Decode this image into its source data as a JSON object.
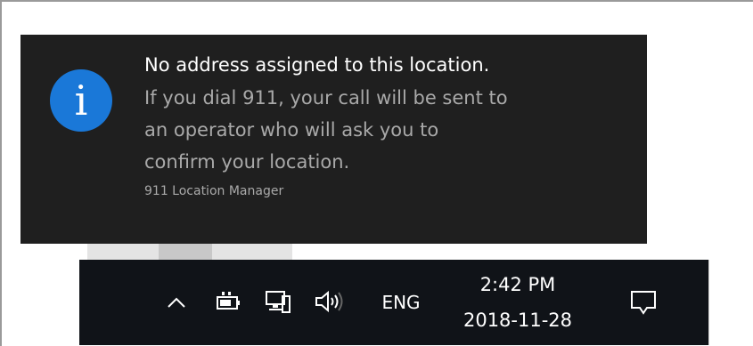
{
  "toast": {
    "icon": "info-icon",
    "icon_glyph": "i",
    "title": "No address assigned to this location.",
    "body_lines": [
      "If you dial 911, your call will be sent to",
      "an operator who will ask you to",
      "confirm your location."
    ],
    "source": "911 Location Manager",
    "icon_color": "#1a78d8",
    "background": "#1f1f1f"
  },
  "taskbar": {
    "background": "#101318",
    "tray": {
      "chevron_icon": "chevron-up-icon",
      "battery_icon": "battery-icon",
      "network_icon": "network-icon",
      "volume_icon": "volume-icon",
      "language": "ENG"
    },
    "clock": {
      "time": "2:42 PM",
      "date": "2018-11-28"
    },
    "action_center_icon": "action-center-icon"
  }
}
